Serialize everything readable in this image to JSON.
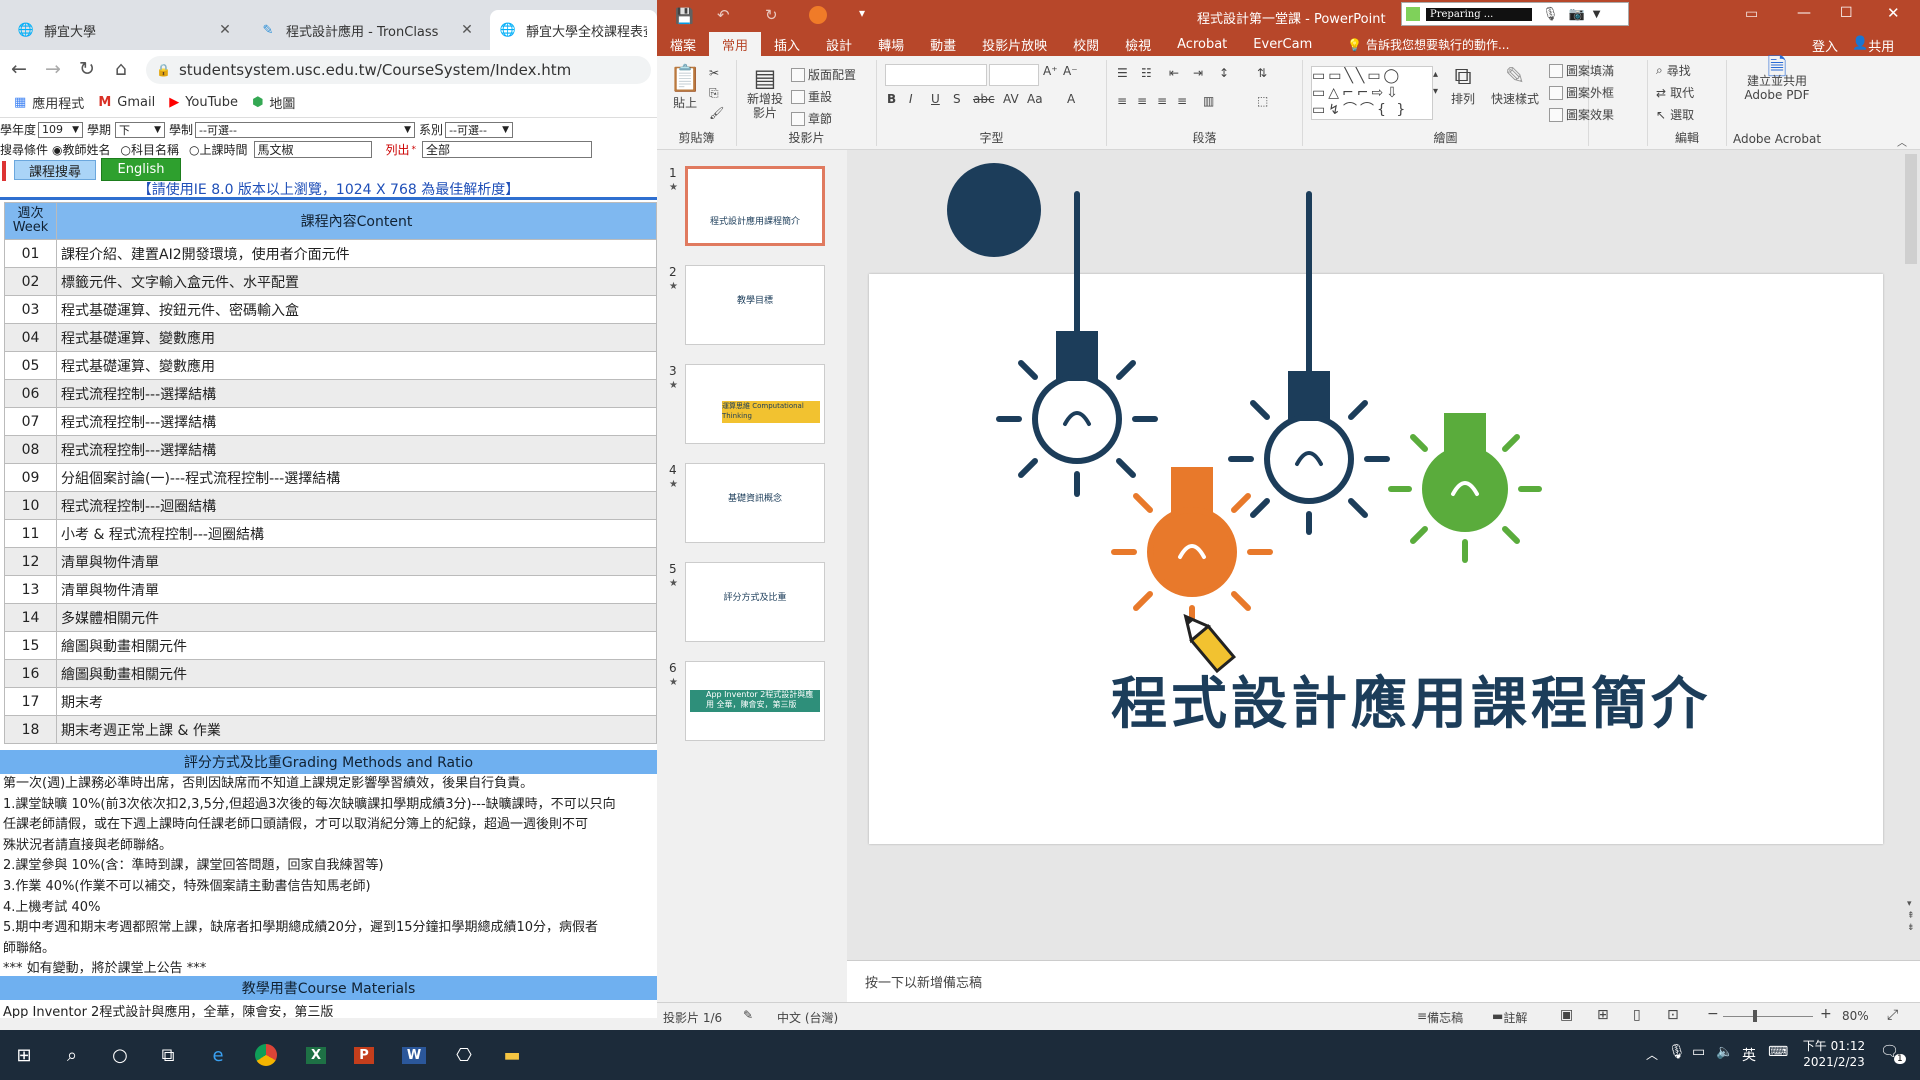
{
  "chrome": {
    "tabs": [
      {
        "title": "靜宜大學",
        "active": false
      },
      {
        "title": "程式設計應用 - TronClass",
        "active": false
      },
      {
        "title": "靜宜大學全校課程表查詢",
        "active": true
      }
    ],
    "url": "studentsystem.usc.edu.tw/CourseSystem/Index.htm",
    "bookmarks": [
      "應用程式",
      "Gmail",
      "YouTube",
      "地圖"
    ]
  },
  "course_page": {
    "form": {
      "year_label": "學年度",
      "year_value": "109",
      "term_label": "學期",
      "term_value": "下",
      "system_label": "學制",
      "system_value": "--可選--",
      "dept_label": "系別",
      "dept_value": "--可選--",
      "search_label": "搜尋條件",
      "radio_teacher": "教師姓名",
      "radio_subject": "科目名稱",
      "radio_time": "上課時間",
      "teacher_value": "馬文椒",
      "list_label": "列出",
      "list_value": "全部",
      "search_button": "課程搜尋",
      "english_button": "English",
      "notice": "【請使用IE 8.0 版本以上瀏覽，1024 X 768 為最佳解析度】"
    },
    "table": {
      "col_week": "週次Week",
      "col_content": "課程內容Content",
      "rows": [
        {
          "week": "01",
          "content": "課程介紹、建置AI2開發環境，使用者介面元件"
        },
        {
          "week": "02",
          "content": "標籤元件、文字輸入盒元件、水平配置"
        },
        {
          "week": "03",
          "content": "程式基礎運算、按鈕元件、密碼輸入盒"
        },
        {
          "week": "04",
          "content": "程式基礎運算、變數應用"
        },
        {
          "week": "05",
          "content": "程式基礎運算、變數應用"
        },
        {
          "week": "06",
          "content": "程式流程控制---選擇結構"
        },
        {
          "week": "07",
          "content": "程式流程控制---選擇結構"
        },
        {
          "week": "08",
          "content": "程式流程控制---選擇結構"
        },
        {
          "week": "09",
          "content": "分組個案討論(一)---程式流程控制---選擇結構"
        },
        {
          "week": "10",
          "content": "程式流程控制---迴圈結構"
        },
        {
          "week": "11",
          "content": "小考 & 程式流程控制---迴圈結構"
        },
        {
          "week": "12",
          "content": "清單與物件清單"
        },
        {
          "week": "13",
          "content": "清單與物件清單"
        },
        {
          "week": "14",
          "content": "多媒體相關元件"
        },
        {
          "week": "15",
          "content": "繪圖與動畫相關元件"
        },
        {
          "week": "16",
          "content": "繪圖與動畫相關元件"
        },
        {
          "week": "17",
          "content": "期末考"
        },
        {
          "week": "18",
          "content": "期末考週正常上課 & 作業"
        }
      ]
    },
    "grading_header": "評分方式及比重Grading Methods and Ratio",
    "grading_lines": [
      "第一次(週)上課務必準時出席，否則因缺席而不知道上課規定影響學習績效，後果自行負責。",
      "1.課堂缺曠 10%(前3次依次扣2,3,5分,但超過3次後的每次缺曠課扣學期成績3分)---缺曠課時，不可以只向",
      "任課老師請假，或在下週上課時向任課老師口頭請假，才可以取消紀分簿上的紀錄，超過一週後則不可",
      "殊狀況者請直接與老師聯絡。",
      "2.課堂參與 10%(含：準時到課，課堂回答問題，回家自我練習等)",
      "3.作業 40%(作業不可以補交，特殊個案請主動書信告知馬老師)",
      "4.上機考試 40%",
      "5.期中考週和期末考週都照常上課，缺席者扣學期總成績20分，遲到15分鐘扣學期總成績10分，病假者",
      "師聯絡。",
      "*** 如有變動，將於課堂上公告 ***"
    ],
    "materials_header": "教學用書Course Materials",
    "materials_line": "App Inventor 2程式設計與應用，全華，陳會安，第三版"
  },
  "powerpoint": {
    "window_title": "程式設計第一堂課 - PowerPoint",
    "preparing": "Preparing ...",
    "tabs": [
      "檔案",
      "常用",
      "插入",
      "設計",
      "轉場",
      "動畫",
      "投影片放映",
      "校閱",
      "檢視",
      "Acrobat",
      "EverCam"
    ],
    "active_tab": "常用",
    "tell_me": "告訴我您想要執行的動作...",
    "sign_in": "登入",
    "share": "共用",
    "ribbon_groups": [
      "剪貼簿",
      "投影片",
      "字型",
      "段落",
      "繪圖",
      "編輯",
      "Adobe Acrobat"
    ],
    "ribbon_items": {
      "paste": "貼上",
      "new_slide": "新增投影片",
      "layout": "版面配置",
      "reset": "重設",
      "section": "章節",
      "arrange": "排列",
      "quick_styles": "快速樣式",
      "shape_fill": "圖案填滿",
      "shape_outline": "圖案外框",
      "shape_effects": "圖案效果",
      "find": "尋找",
      "replace": "取代",
      "select": "選取",
      "create_pdf": "建立並共用 Adobe PDF"
    },
    "thumbnails": [
      {
        "num": "1",
        "caption": "程式設計應用課程簡介"
      },
      {
        "num": "2",
        "caption": "教學目標"
      },
      {
        "num": "3",
        "caption": "運算思維 Computational Thinking"
      },
      {
        "num": "4",
        "caption": "基礎資訊概念"
      },
      {
        "num": "5",
        "caption": "評分方式及比重"
      },
      {
        "num": "6",
        "caption": "App Inventor 2程式設計與應用 全華，陳會安，第三版"
      }
    ],
    "slide_title": "程式設計應用課程簡介",
    "notes_placeholder": "按一下以新增備忘稿",
    "status_slide": "投影片 1/6",
    "status_lang": "中文 (台灣)",
    "status_notes": "備忘稿",
    "status_comments": "註解",
    "zoom": "80%"
  },
  "taskbar": {
    "time": "下午 01:12",
    "date": "2021/2/23",
    "ime": "英",
    "notif": "1"
  },
  "colors": {
    "ppt_red": "#b7472a",
    "slide_navy": "#1c3d5a",
    "slide_orange": "#e8792b",
    "slide_green": "#5aac3c",
    "table_header_blue": "#7fb8f0"
  }
}
